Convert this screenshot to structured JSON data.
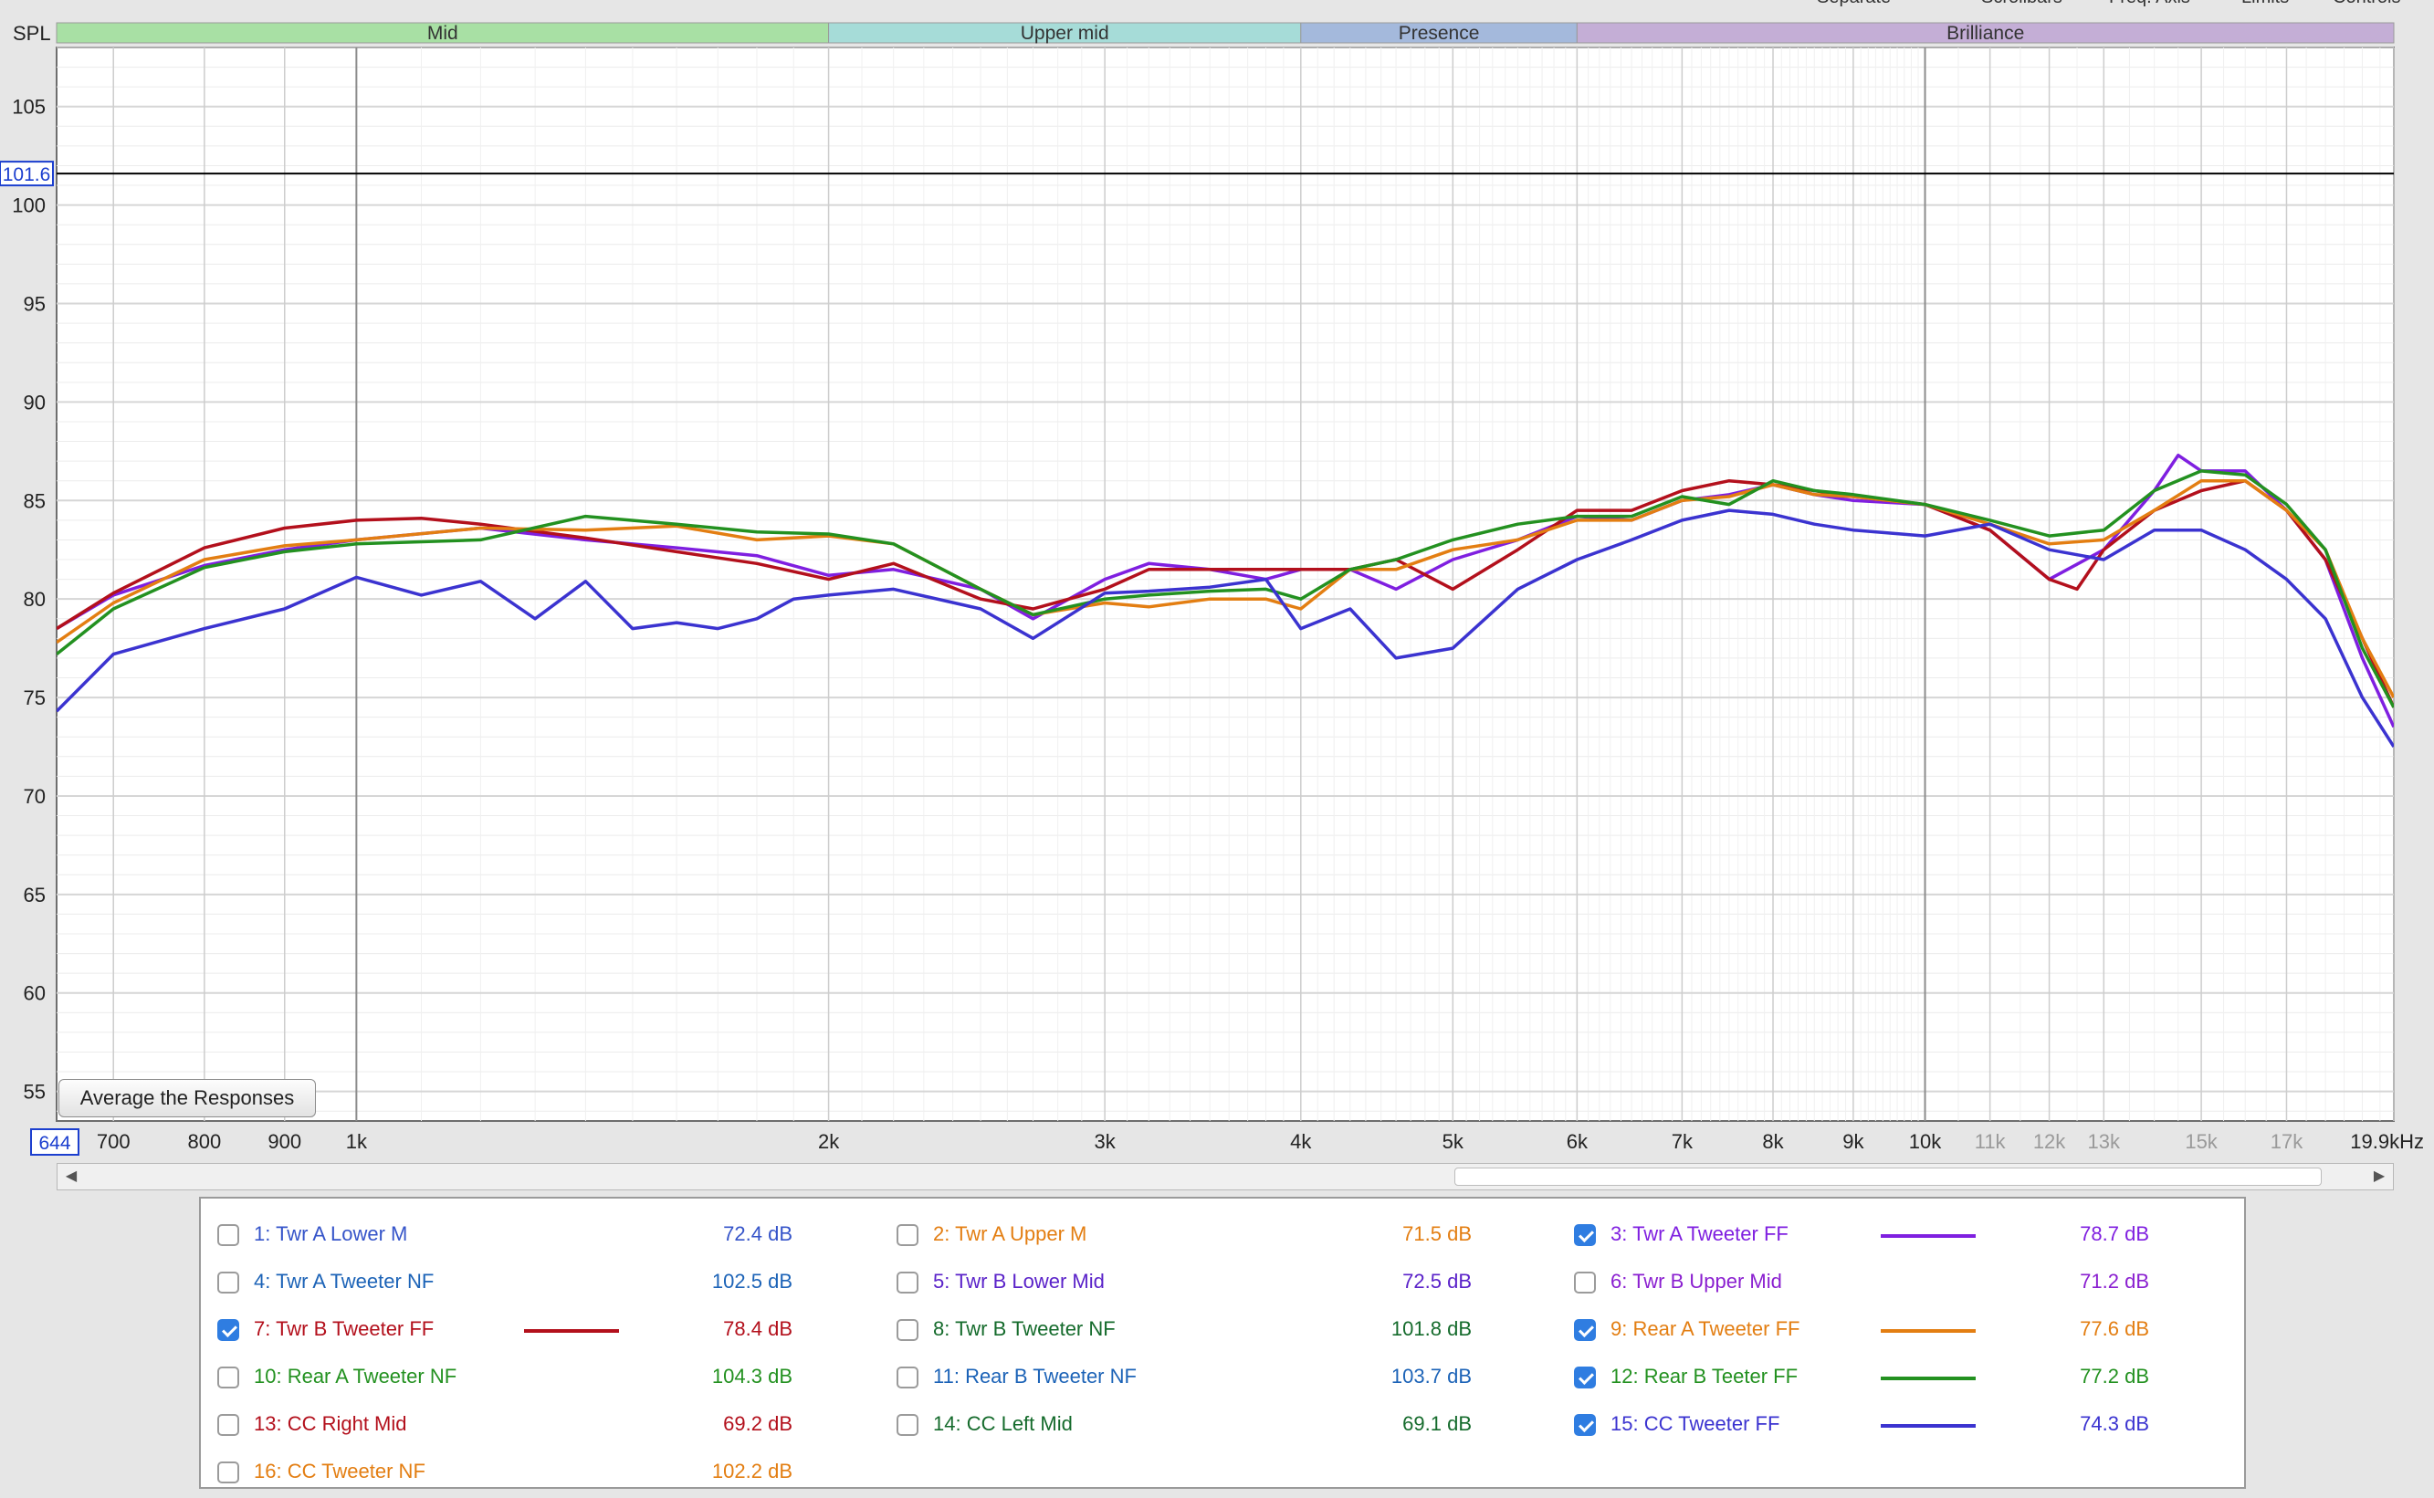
{
  "menu": {
    "items": [
      "Separate",
      "Scrollbars",
      "Freq. Axis",
      "Limits",
      "Controls"
    ]
  },
  "buttons": {
    "average_label": "Average the Responses"
  },
  "colors": {
    "accent": "#2f7de1",
    "grid": "#d6d6d6",
    "plot_bg": "#ffffff"
  },
  "chart_data": {
    "type": "line",
    "title": "",
    "ylabel": "SPL",
    "xlabel": "",
    "x_scale": "log",
    "xlim": [
      644,
      19900
    ],
    "ylim": [
      53.5,
      108
    ],
    "grid": true,
    "cursor_y": 101.6,
    "cursor_y_label": "101.6",
    "x_start_label": "644",
    "x_ticks": [
      {
        "v": 700,
        "t": "700"
      },
      {
        "v": 800,
        "t": "800"
      },
      {
        "v": 900,
        "t": "900"
      },
      {
        "v": 1000,
        "t": "1k"
      },
      {
        "v": 2000,
        "t": "2k"
      },
      {
        "v": 3000,
        "t": "3k"
      },
      {
        "v": 4000,
        "t": "4k"
      },
      {
        "v": 5000,
        "t": "5k"
      },
      {
        "v": 6000,
        "t": "6k"
      },
      {
        "v": 7000,
        "t": "7k"
      },
      {
        "v": 8000,
        "t": "8k"
      },
      {
        "v": 9000,
        "t": "9k"
      },
      {
        "v": 10000,
        "t": "10k"
      },
      {
        "v": 11000,
        "t": "11k",
        "minor": true
      },
      {
        "v": 12000,
        "t": "12k",
        "minor": true
      },
      {
        "v": 13000,
        "t": "13k",
        "minor": true
      },
      {
        "v": 15000,
        "t": "15k",
        "minor": true
      },
      {
        "v": 17000,
        "t": "17k",
        "minor": true
      },
      {
        "v": 19900,
        "t": "19.9kHz"
      }
    ],
    "y_ticks": [
      55,
      60,
      65,
      70,
      75,
      80,
      85,
      90,
      95,
      100,
      105
    ],
    "bands": [
      {
        "name": "Mid",
        "from": 644,
        "to": 2000,
        "color": "#a8e0a4"
      },
      {
        "name": "Upper mid",
        "from": 2000,
        "to": 4000,
        "color": "#a6dcd8"
      },
      {
        "name": "Presence",
        "from": 4000,
        "to": 6000,
        "color": "#a4b9dc"
      },
      {
        "name": "Brilliance",
        "from": 6000,
        "to": 19900,
        "color": "#c4aed6"
      }
    ],
    "series": [
      {
        "name": "3: Twr A Tweeter FF",
        "color": "#7f1fe0",
        "x": [
          644,
          700,
          800,
          900,
          1000,
          1200,
          1400,
          1600,
          1800,
          2000,
          2200,
          2500,
          2700,
          3000,
          3200,
          3500,
          3800,
          4000,
          4300,
          4600,
          5000,
          5500,
          6000,
          6500,
          7000,
          7500,
          8000,
          8500,
          9000,
          10000,
          11000,
          12000,
          13000,
          14000,
          14500,
          15000,
          16000,
          17000,
          18000,
          19000,
          19900
        ],
        "y": [
          78.5,
          80.2,
          81.7,
          82.5,
          83.0,
          83.6,
          83.0,
          82.6,
          82.2,
          81.2,
          81.5,
          80.5,
          79.0,
          81.0,
          81.8,
          81.5,
          81.0,
          81.5,
          81.5,
          80.5,
          82.0,
          83.0,
          84.2,
          84.0,
          85.0,
          85.3,
          85.8,
          85.3,
          85.0,
          84.8,
          83.5,
          81.0,
          82.5,
          85.5,
          87.3,
          86.5,
          86.5,
          84.5,
          82.0,
          77.0,
          73.5
        ]
      },
      {
        "name": "7: Twr B Tweeter FF",
        "color": "#b3101c",
        "x": [
          644,
          700,
          800,
          900,
          1000,
          1100,
          1200,
          1400,
          1600,
          1800,
          2000,
          2200,
          2500,
          2700,
          3000,
          3200,
          3500,
          3800,
          4000,
          4300,
          4600,
          5000,
          5500,
          6000,
          6500,
          7000,
          7500,
          8000,
          8500,
          9000,
          10000,
          11000,
          12000,
          12500,
          13000,
          14000,
          15000,
          16000,
          17000,
          18000,
          19000,
          19900
        ],
        "y": [
          78.5,
          80.3,
          82.6,
          83.6,
          84.0,
          84.1,
          83.8,
          83.1,
          82.4,
          81.8,
          81.0,
          81.8,
          80.0,
          79.5,
          80.5,
          81.5,
          81.5,
          81.5,
          81.5,
          81.5,
          82.0,
          80.5,
          82.5,
          84.5,
          84.5,
          85.5,
          86.0,
          85.8,
          85.5,
          85.2,
          84.8,
          83.5,
          81.0,
          80.5,
          82.5,
          84.5,
          85.5,
          86.0,
          84.5,
          82.0,
          78.0,
          74.5
        ]
      },
      {
        "name": "9: Rear A Tweeter FF",
        "color": "#e37e12",
        "x": [
          644,
          700,
          800,
          900,
          1000,
          1200,
          1400,
          1600,
          1800,
          2000,
          2200,
          2500,
          2700,
          3000,
          3200,
          3500,
          3800,
          4000,
          4300,
          4600,
          5000,
          5500,
          6000,
          6500,
          7000,
          7500,
          8000,
          8500,
          9000,
          10000,
          11000,
          12000,
          13000,
          14000,
          15000,
          16000,
          17000,
          18000,
          19000,
          19900
        ],
        "y": [
          77.8,
          79.8,
          82.0,
          82.7,
          83.0,
          83.6,
          83.5,
          83.7,
          83.0,
          83.2,
          82.8,
          80.5,
          79.2,
          79.8,
          79.6,
          80.0,
          80.0,
          79.5,
          81.5,
          81.5,
          82.5,
          83.0,
          84.0,
          84.0,
          85.0,
          85.2,
          85.8,
          85.3,
          85.2,
          84.8,
          83.8,
          82.8,
          83.0,
          84.5,
          86.0,
          86.0,
          84.5,
          82.5,
          78.0,
          75.0
        ]
      },
      {
        "name": "12: Rear B Teeter FF",
        "color": "#239120",
        "x": [
          644,
          700,
          800,
          900,
          1000,
          1200,
          1400,
          1600,
          1800,
          2000,
          2200,
          2500,
          2700,
          3000,
          3200,
          3500,
          3800,
          4000,
          4300,
          4600,
          5000,
          5500,
          6000,
          6500,
          7000,
          7500,
          8000,
          8500,
          9000,
          10000,
          11000,
          12000,
          13000,
          14000,
          15000,
          16000,
          17000,
          18000,
          19000,
          19900
        ],
        "y": [
          77.2,
          79.5,
          81.6,
          82.4,
          82.8,
          83.0,
          84.2,
          83.8,
          83.4,
          83.3,
          82.8,
          80.5,
          79.2,
          80.0,
          80.2,
          80.4,
          80.5,
          80.0,
          81.5,
          82.0,
          83.0,
          83.8,
          84.2,
          84.2,
          85.2,
          84.8,
          86.0,
          85.5,
          85.3,
          84.8,
          84.0,
          83.2,
          83.5,
          85.5,
          86.5,
          86.3,
          84.8,
          82.5,
          77.5,
          74.5
        ]
      },
      {
        "name": "15: CC Tweeter FF",
        "color": "#3b33d0",
        "x": [
          644,
          700,
          800,
          900,
          1000,
          1100,
          1200,
          1300,
          1400,
          1500,
          1600,
          1700,
          1800,
          1900,
          2000,
          2200,
          2500,
          2700,
          3000,
          3200,
          3500,
          3800,
          4000,
          4300,
          4600,
          5000,
          5500,
          6000,
          6500,
          7000,
          7500,
          8000,
          8500,
          9000,
          10000,
          11000,
          12000,
          13000,
          14000,
          15000,
          16000,
          17000,
          18000,
          19000,
          19900
        ],
        "y": [
          74.3,
          77.2,
          78.5,
          79.5,
          81.1,
          80.2,
          80.9,
          79.0,
          80.9,
          78.5,
          78.8,
          78.5,
          79.0,
          80.0,
          80.2,
          80.5,
          79.5,
          78.0,
          80.3,
          80.4,
          80.6,
          81.0,
          78.5,
          79.5,
          77.0,
          77.5,
          80.5,
          82.0,
          83.0,
          84.0,
          84.5,
          84.3,
          83.8,
          83.5,
          83.2,
          83.8,
          82.5,
          82.0,
          83.5,
          83.5,
          82.5,
          81.0,
          79.0,
          75.0,
          72.5
        ]
      }
    ]
  },
  "legend": {
    "items": [
      {
        "label": "1: Twr A Lower M",
        "value": "72.4 dB",
        "checked": false,
        "color": "#3554c9"
      },
      {
        "label": "2: Twr A Upper M",
        "value": "71.5 dB",
        "checked": false,
        "color": "#e37e12"
      },
      {
        "label": "3: Twr A Tweeter FF",
        "value": "78.7 dB",
        "checked": true,
        "color": "#7f1fe0"
      },
      {
        "label": "4: Twr A Tweeter NF",
        "value": "102.5 dB",
        "checked": false,
        "color": "#1c63b7"
      },
      {
        "label": "5: Twr B Lower Mid",
        "value": "72.5 dB",
        "checked": false,
        "color": "#5a22c9"
      },
      {
        "label": "6: Twr B Upper Mid",
        "value": "71.2 dB",
        "checked": false,
        "color": "#8a1fd0"
      },
      {
        "label": "7: Twr B Tweeter FF",
        "value": "78.4 dB",
        "checked": true,
        "color": "#b3101c"
      },
      {
        "label": "8: Twr B Tweeter NF",
        "value": "101.8 dB",
        "checked": false,
        "color": "#156b2c"
      },
      {
        "label": "9: Rear A Tweeter FF",
        "value": "77.6 dB",
        "checked": true,
        "color": "#e37e12"
      },
      {
        "label": "10: Rear A Tweeter NF",
        "value": "104.3 dB",
        "checked": false,
        "color": "#239120"
      },
      {
        "label": "11: Rear B Tweeter NF",
        "value": "103.7 dB",
        "checked": false,
        "color": "#1c63b7"
      },
      {
        "label": "12: Rear B Teeter FF",
        "value": "77.2 dB",
        "checked": true,
        "color": "#239120"
      },
      {
        "label": "13: CC Right Mid",
        "value": "69.2 dB",
        "checked": false,
        "color": "#b3101c"
      },
      {
        "label": "14: CC Left Mid",
        "value": "69.1 dB",
        "checked": false,
        "color": "#156b2c"
      },
      {
        "label": "15: CC Tweeter FF",
        "value": "74.3 dB",
        "checked": true,
        "color": "#3b33d0"
      },
      {
        "label": "16: CC Tweeter NF",
        "value": "102.2 dB",
        "checked": false,
        "color": "#e37e12"
      }
    ]
  }
}
